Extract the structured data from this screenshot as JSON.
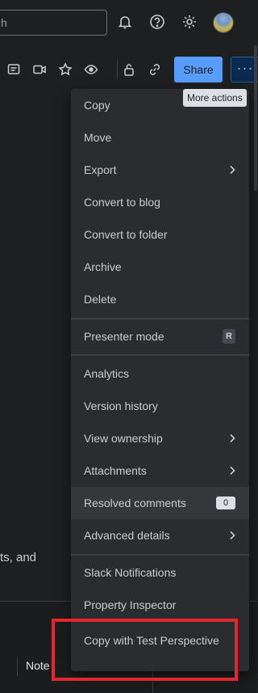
{
  "header": {
    "search_placeholder": "h",
    "icons": [
      "notifications-icon",
      "help-icon",
      "settings-icon"
    ]
  },
  "toolbar": {
    "icons": [
      "comment-icon",
      "video-icon",
      "star-icon",
      "watch-icon",
      "restrictions-icon",
      "copy-link-icon"
    ],
    "share_label": "Share",
    "more_label": "···",
    "tooltip": "More actions"
  },
  "page": {
    "body_fragment": "ts, and",
    "bottom_label": "Note"
  },
  "menu": {
    "group1": [
      {
        "label": "Copy"
      },
      {
        "label": "Move"
      },
      {
        "label": "Export",
        "submenu": true
      },
      {
        "label": "Convert to blog"
      },
      {
        "label": "Convert to folder"
      },
      {
        "label": "Archive"
      },
      {
        "label": "Delete"
      }
    ],
    "presenter": {
      "label": "Presenter mode",
      "shortcut": "R"
    },
    "group2": [
      {
        "label": "Analytics"
      },
      {
        "label": "Version history"
      },
      {
        "label": "View ownership",
        "submenu": true
      },
      {
        "label": "Attachments",
        "submenu": true
      },
      {
        "label": "Resolved comments",
        "count": "0"
      },
      {
        "label": "Advanced details",
        "submenu": true
      }
    ],
    "group3": [
      {
        "label": "Slack Notifications"
      },
      {
        "label": "Property Inspector"
      },
      {
        "label": "Copy with Test Perspective"
      }
    ]
  },
  "colors": {
    "accent": "#579dff",
    "highlight": "#e5262f",
    "menu_bg": "#2b2c2f"
  }
}
